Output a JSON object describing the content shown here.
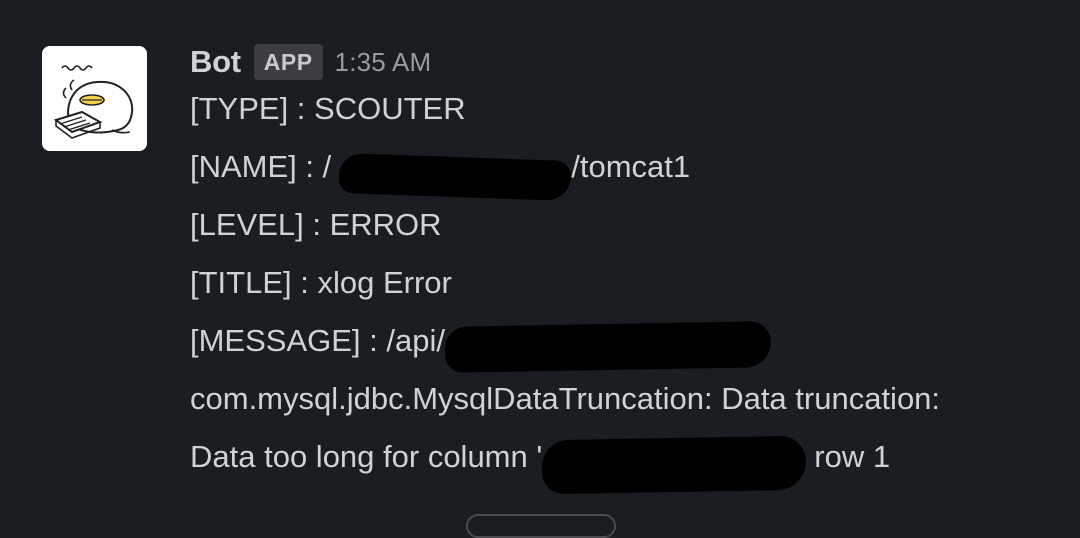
{
  "message": {
    "author": "Bot",
    "badge": "APP",
    "timestamp": "1:35 AM",
    "avatar_icon": "bird-reading-book-icon",
    "lines": {
      "type_label": "[TYPE] : ",
      "type_value": "SCOUTER",
      "name_label": "[NAME] : ",
      "name_prefix": "/",
      "name_suffix": "/tomcat1",
      "level_label": "[LEVEL] : ",
      "level_value": "ERROR",
      "title_label": "[TITLE] : ",
      "title_value": "xlog Error",
      "message_label": "[MESSAGE] : ",
      "message_value": "/api/",
      "exception": "com.mysql.jdbc.MysqlDataTruncation: Data truncation:",
      "detail_prefix": "Data too long for column '",
      "detail_suffix": "row 1"
    }
  },
  "colors": {
    "background": "#1a1d21",
    "text": "#d1d2d3",
    "muted": "#9a9b9d",
    "badge_bg": "#3b3d42"
  }
}
